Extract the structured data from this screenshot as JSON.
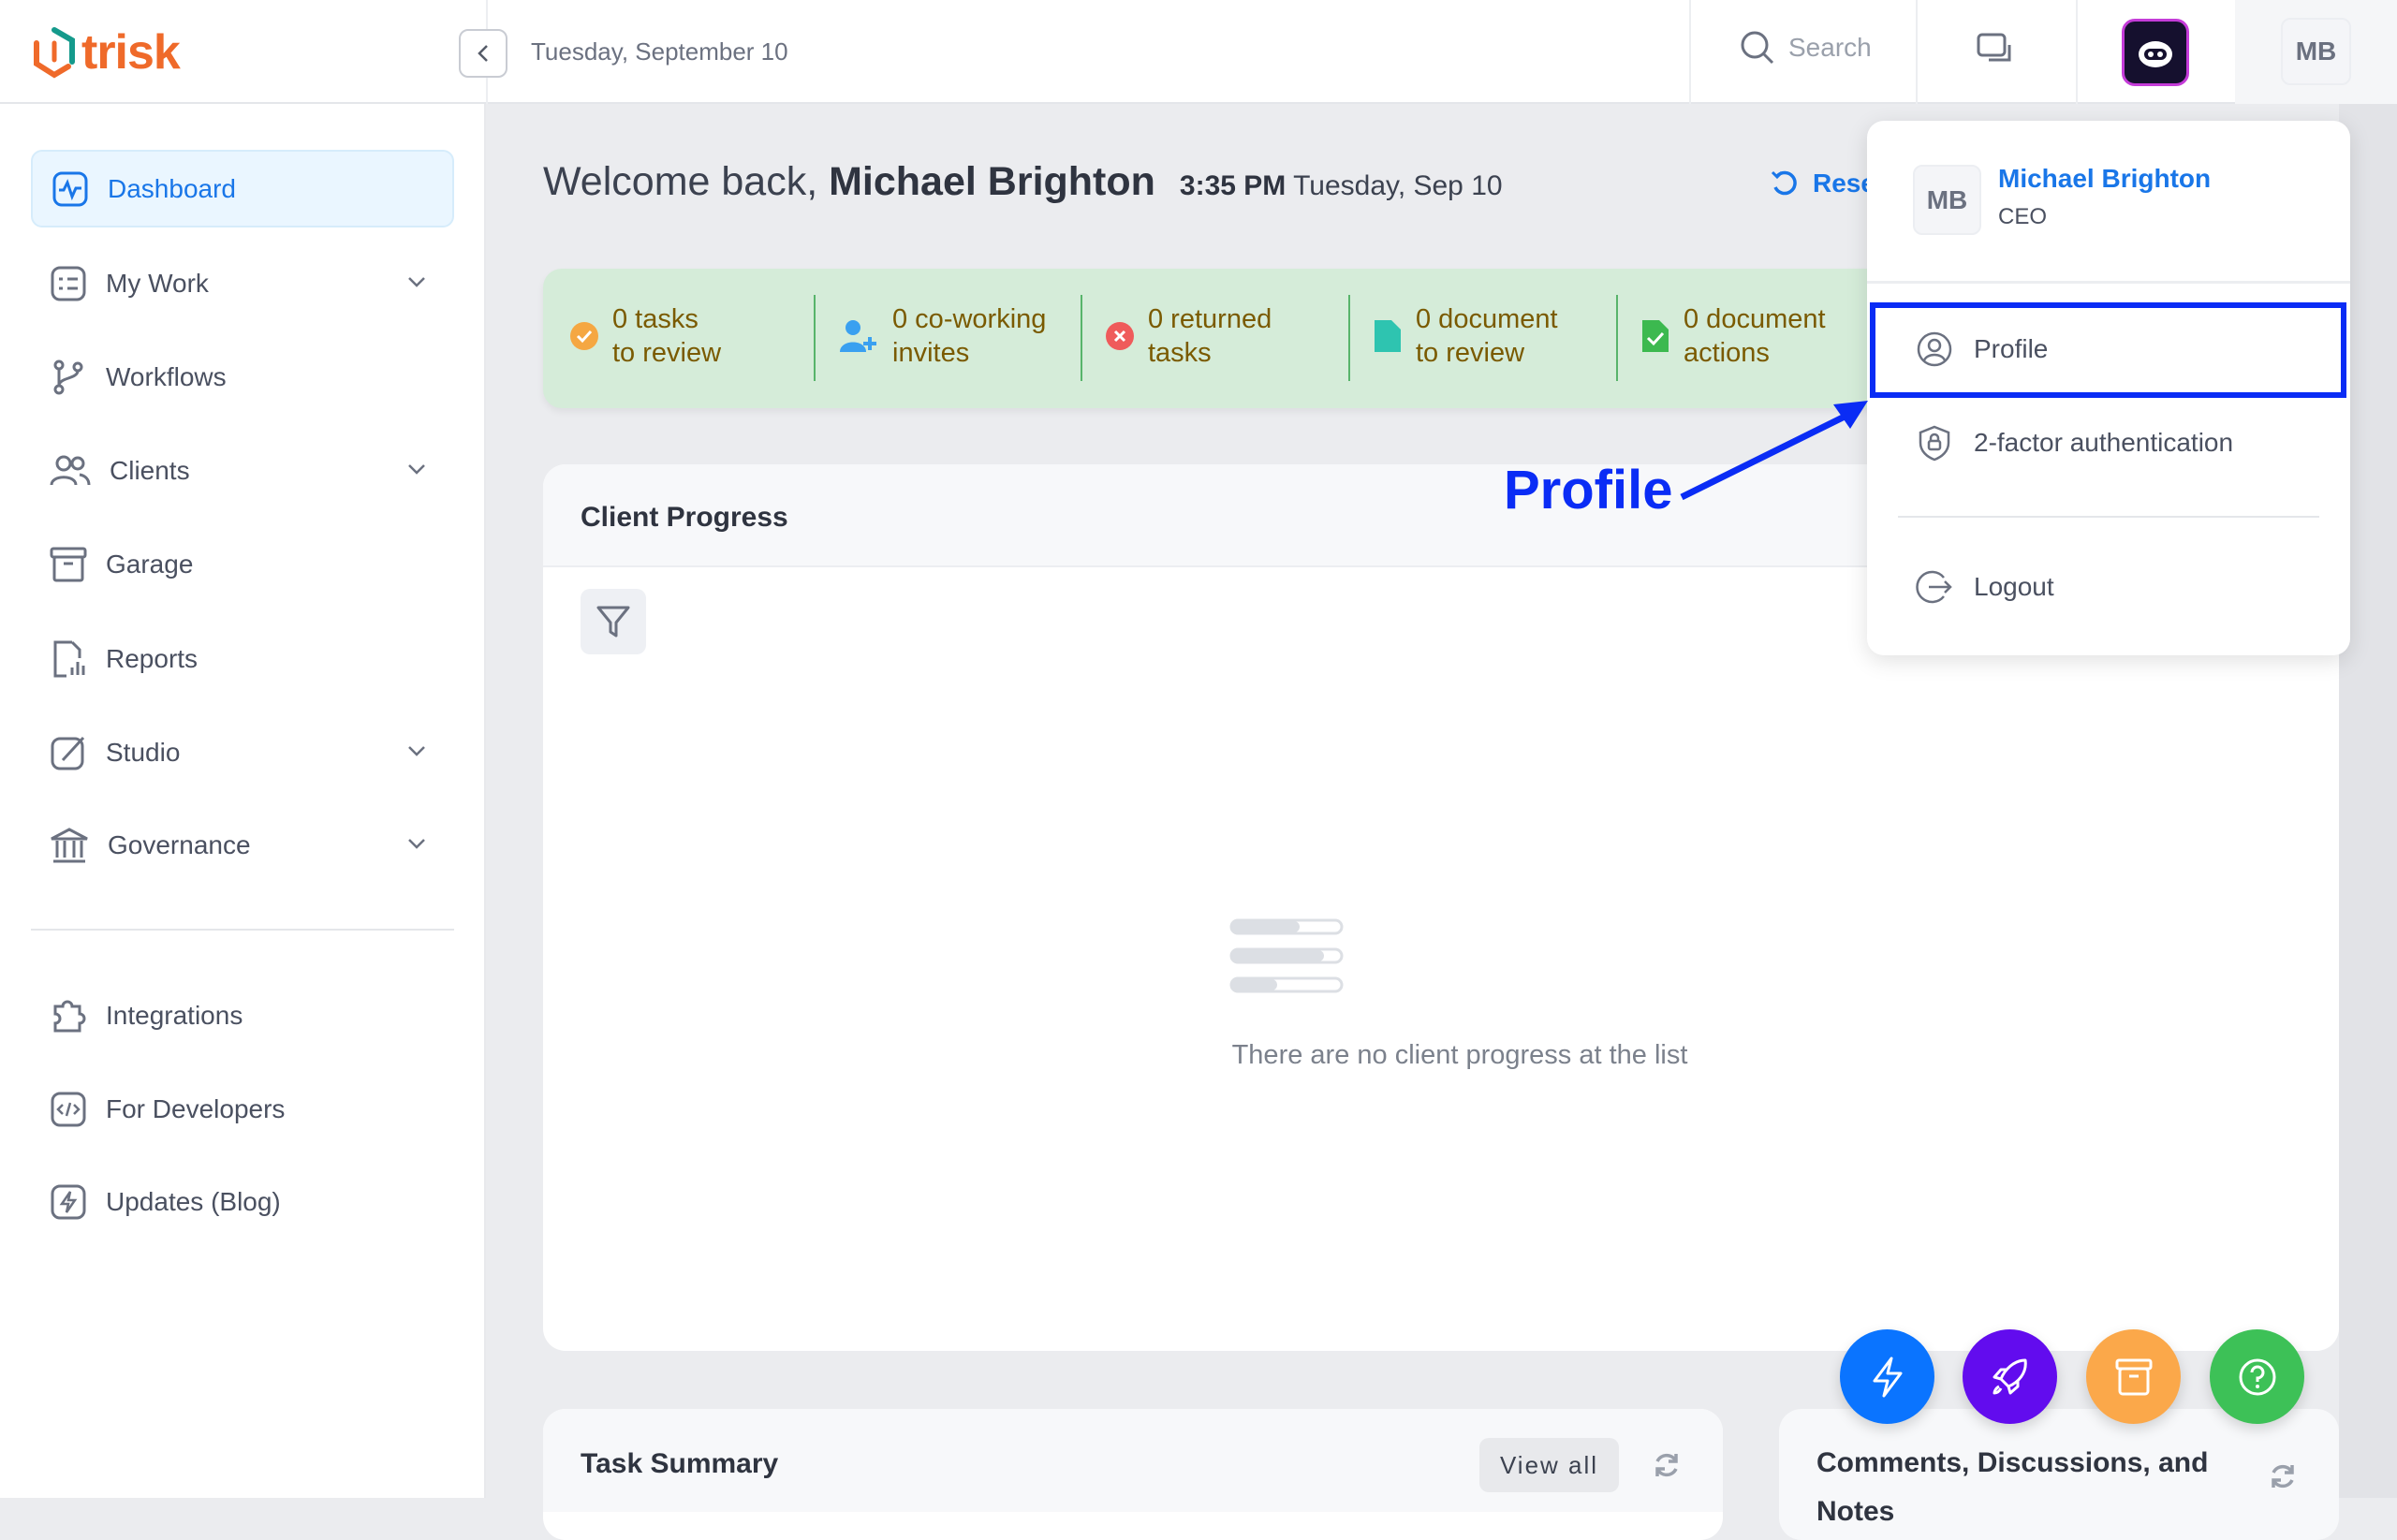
{
  "brand": {
    "name": "trisk",
    "colors": {
      "accent": "#1976e8",
      "logo_orange": "#ef6a2a",
      "logo_teal": "#159a8c"
    }
  },
  "header": {
    "date": "Tuesday, September 10",
    "search_label": "Search",
    "user_initials": "MB"
  },
  "sidebar": {
    "items": [
      {
        "label": "Dashboard",
        "icon": "activity-icon",
        "active": true
      },
      {
        "label": "My Work",
        "icon": "checklist-icon",
        "expandable": true
      },
      {
        "label": "Workflows",
        "icon": "git-branch-icon"
      },
      {
        "label": "Clients",
        "icon": "users-icon",
        "expandable": true
      },
      {
        "label": "Garage",
        "icon": "archive-icon"
      },
      {
        "label": "Reports",
        "icon": "report-icon"
      },
      {
        "label": "Studio",
        "icon": "brush-icon",
        "expandable": true
      },
      {
        "label": "Governance",
        "icon": "bank-icon",
        "expandable": true
      }
    ],
    "bottom_items": [
      {
        "label": "Integrations",
        "icon": "puzzle-icon"
      },
      {
        "label": "For Developers",
        "icon": "code-icon"
      },
      {
        "label": "Updates (Blog)",
        "icon": "bolt-icon"
      }
    ]
  },
  "main": {
    "welcome_prefix": "Welcome back, ",
    "user_name": "Michael Brighton",
    "time": "3:35 PM",
    "date_short": "Tuesday, Sep 10",
    "reset_label": "Rese",
    "stats": [
      {
        "line1": "0 tasks",
        "line2": "to review",
        "icon": "check-circle-icon",
        "color": "#f5a742"
      },
      {
        "line1": "0 co-working",
        "line2": "invites",
        "icon": "user-plus-icon",
        "color": "#3aa0f0"
      },
      {
        "line1": "0 returned",
        "line2": "tasks",
        "icon": "x-circle-icon",
        "color": "#ef5b5b"
      },
      {
        "line1": "0 document",
        "line2": "to review",
        "icon": "document-icon",
        "color": "#2ec4b0"
      },
      {
        "line1": "0 document",
        "line2": "actions",
        "icon": "document-check-icon",
        "color": "#3cb94f"
      }
    ],
    "client_progress": {
      "title": "Client Progress",
      "empty_text": "There are no client progress at the list"
    },
    "task_summary": {
      "title": "Task Summary",
      "view_all": "View all"
    },
    "comments": {
      "title": "Comments, Discussions, and Notes"
    }
  },
  "fabs": [
    {
      "icon": "bolt-icon",
      "color": "#0a74ff"
    },
    {
      "icon": "rocket-icon",
      "color": "#620cee"
    },
    {
      "icon": "archive-icon",
      "color": "#fba84a"
    },
    {
      "icon": "help-circle-icon",
      "color": "#3dc157"
    }
  ],
  "dropdown": {
    "initials": "MB",
    "name": "Michael Brighton",
    "role": "CEO",
    "items": [
      {
        "label": "Profile",
        "icon": "user-circle-icon"
      },
      {
        "label": "2-factor authentication",
        "icon": "shield-lock-icon"
      },
      {
        "label": "Logout",
        "icon": "logout-icon"
      }
    ]
  },
  "annotation": {
    "label": "Profile",
    "color": "#0a2cf5"
  }
}
